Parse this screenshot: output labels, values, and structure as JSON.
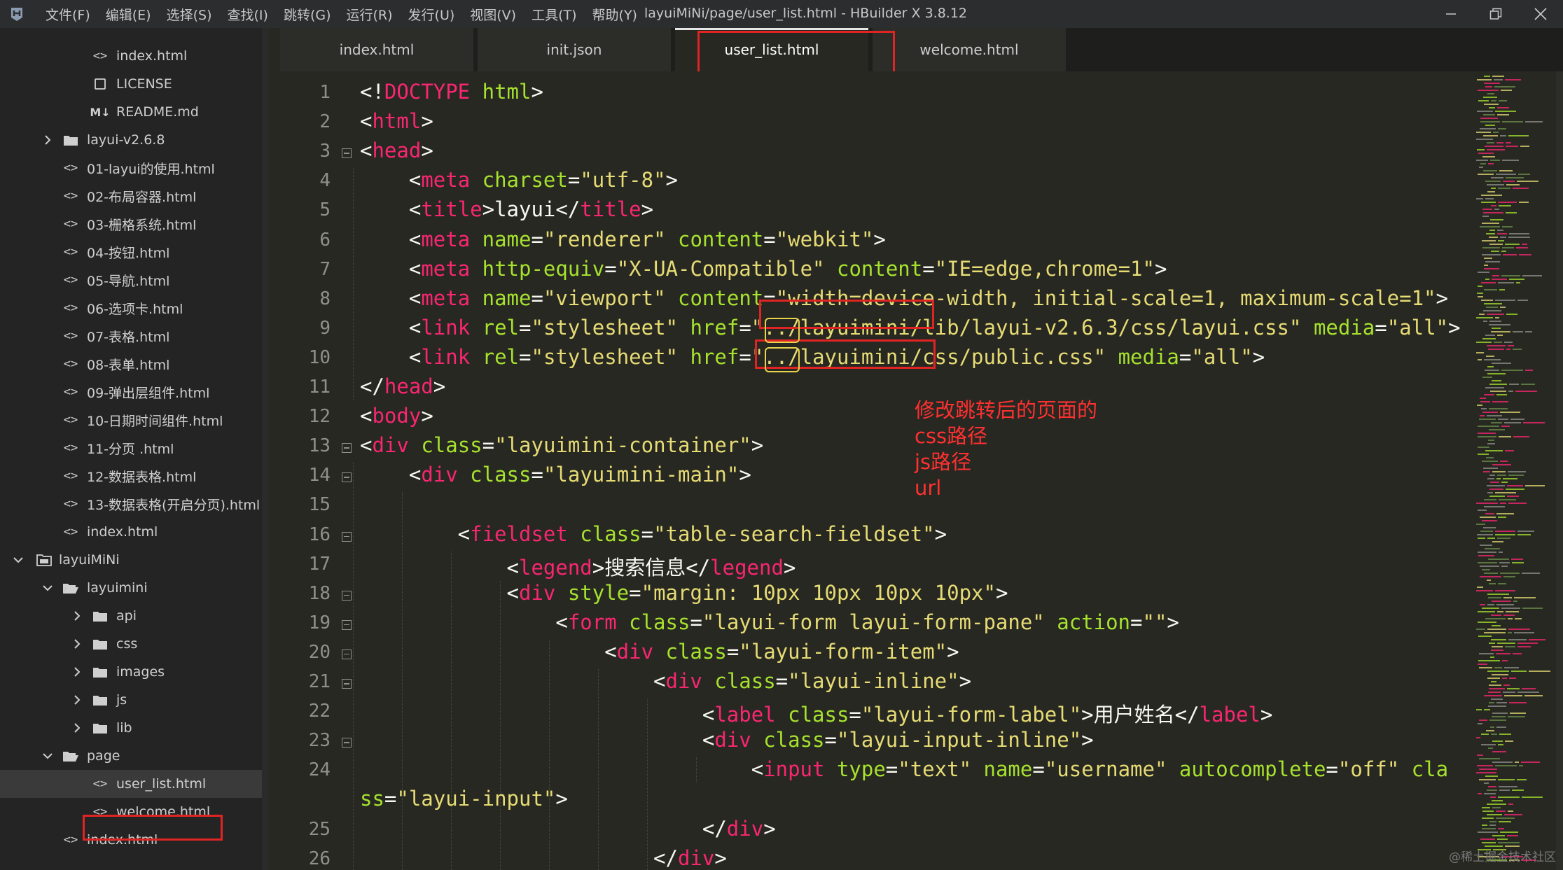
{
  "app": {
    "window_title": "layuiMiNi/page/user_list.html - HBuilder X 3.8.12",
    "menu": [
      "文件(F)",
      "编辑(E)",
      "选择(S)",
      "查找(I)",
      "跳转(G)",
      "运行(R)",
      "发行(U)",
      "视图(V)",
      "工具(T)",
      "帮助(Y)"
    ]
  },
  "sidebar": {
    "items": [
      {
        "label": "index.html",
        "icon": "code-file-icon",
        "depth": 3
      },
      {
        "label": "LICENSE",
        "icon": "plain-file-icon",
        "depth": 3
      },
      {
        "label": "README.md",
        "icon": "markdown-file-icon",
        "depth": 3
      },
      {
        "label": "layui-v2.6.8",
        "icon": "folder-icon",
        "depth": 2,
        "chevron": "right"
      },
      {
        "label": "01-layui的使用.html",
        "icon": "code-file-icon",
        "depth": 2
      },
      {
        "label": "02-布局容器.html",
        "icon": "code-file-icon",
        "depth": 2
      },
      {
        "label": "03-栅格系统.html",
        "icon": "code-file-icon",
        "depth": 2
      },
      {
        "label": "04-按钮.html",
        "icon": "code-file-icon",
        "depth": 2
      },
      {
        "label": "05-导航.html",
        "icon": "code-file-icon",
        "depth": 2
      },
      {
        "label": "06-选项卡.html",
        "icon": "code-file-icon",
        "depth": 2
      },
      {
        "label": "07-表格.html",
        "icon": "code-file-icon",
        "depth": 2
      },
      {
        "label": "08-表单.html",
        "icon": "code-file-icon",
        "depth": 2
      },
      {
        "label": "09-弹出层组件.html",
        "icon": "code-file-icon",
        "depth": 2
      },
      {
        "label": "10-日期时间组件.html",
        "icon": "code-file-icon",
        "depth": 2
      },
      {
        "label": "11-分页 .html",
        "icon": "code-file-icon",
        "depth": 2
      },
      {
        "label": "12-数据表格.html",
        "icon": "code-file-icon",
        "depth": 2
      },
      {
        "label": "13-数据表格(开启分页).html",
        "icon": "code-file-icon",
        "depth": 2
      },
      {
        "label": "index.html",
        "icon": "code-file-icon",
        "depth": 2
      },
      {
        "label": "layuiMiNi",
        "icon": "project-icon",
        "depth": 1,
        "chevron": "down"
      },
      {
        "label": "layuimini",
        "icon": "folder-open-icon",
        "depth": 2,
        "chevron": "down"
      },
      {
        "label": "api",
        "icon": "folder-icon",
        "depth": 3,
        "chevron": "right"
      },
      {
        "label": "css",
        "icon": "folder-icon",
        "depth": 3,
        "chevron": "right"
      },
      {
        "label": "images",
        "icon": "folder-icon",
        "depth": 3,
        "chevron": "right"
      },
      {
        "label": "js",
        "icon": "folder-icon",
        "depth": 3,
        "chevron": "right"
      },
      {
        "label": "lib",
        "icon": "folder-icon",
        "depth": 3,
        "chevron": "right"
      },
      {
        "label": "page",
        "icon": "folder-open-icon",
        "depth": 2,
        "chevron": "down"
      },
      {
        "label": "user_list.html",
        "icon": "code-file-icon",
        "depth": 3,
        "selected": true
      },
      {
        "label": "welcome.html",
        "icon": "code-file-icon",
        "depth": 3
      },
      {
        "label": "index.html",
        "icon": "code-file-icon",
        "depth": 2
      }
    ]
  },
  "tabs": [
    {
      "label": "index.html",
      "active": false
    },
    {
      "label": "init.json",
      "active": false
    },
    {
      "label": "user_list.html",
      "active": true
    },
    {
      "label": "welcome.html",
      "active": false
    }
  ],
  "editor": {
    "line_numbers": [
      "1",
      "2",
      "3",
      "4",
      "5",
      "6",
      "7",
      "8",
      "9",
      "10",
      "11",
      "12",
      "13",
      "14",
      "15",
      "16",
      "17",
      "18",
      "19",
      "20",
      "21",
      "22",
      "23",
      "24",
      "",
      "25",
      "26"
    ],
    "lines": [
      {
        "tokens": [
          [
            "pn",
            "<!"
          ],
          [
            "tg",
            "DOCTYPE"
          ],
          [
            "pn",
            " "
          ],
          [
            "at",
            "html"
          ],
          [
            "pn",
            ">"
          ]
        ]
      },
      {
        "tokens": [
          [
            "pn",
            "<"
          ],
          [
            "tg",
            "html"
          ],
          [
            "pn",
            ">"
          ]
        ]
      },
      {
        "tokens": [
          [
            "pn",
            "<"
          ],
          [
            "tg",
            "head"
          ],
          [
            "pn",
            ">"
          ]
        ]
      },
      {
        "tokens": [
          [
            "pn",
            "    <"
          ],
          [
            "tg",
            "meta"
          ],
          [
            "pn",
            " "
          ],
          [
            "at",
            "charset"
          ],
          [
            "pn",
            "="
          ],
          [
            "st",
            "\"utf-8\""
          ],
          [
            "pn",
            ">"
          ]
        ]
      },
      {
        "tokens": [
          [
            "pn",
            "    <"
          ],
          [
            "tg",
            "title"
          ],
          [
            "pn",
            ">"
          ],
          [
            "tx",
            "layui"
          ],
          [
            "pn",
            "</"
          ],
          [
            "tg",
            "title"
          ],
          [
            "pn",
            ">"
          ]
        ]
      },
      {
        "tokens": [
          [
            "pn",
            "    <"
          ],
          [
            "tg",
            "meta"
          ],
          [
            "pn",
            " "
          ],
          [
            "at",
            "name"
          ],
          [
            "pn",
            "="
          ],
          [
            "st",
            "\"renderer\""
          ],
          [
            "pn",
            " "
          ],
          [
            "at",
            "content"
          ],
          [
            "pn",
            "="
          ],
          [
            "st",
            "\"webkit\""
          ],
          [
            "pn",
            ">"
          ]
        ]
      },
      {
        "tokens": [
          [
            "pn",
            "    <"
          ],
          [
            "tg",
            "meta"
          ],
          [
            "pn",
            " "
          ],
          [
            "at",
            "http-equiv"
          ],
          [
            "pn",
            "="
          ],
          [
            "st",
            "\"X-UA-Compatible\""
          ],
          [
            "pn",
            " "
          ],
          [
            "at",
            "content"
          ],
          [
            "pn",
            "="
          ],
          [
            "st",
            "\"IE=edge,chrome=1\""
          ],
          [
            "pn",
            ">"
          ]
        ]
      },
      {
        "tokens": [
          [
            "pn",
            "    <"
          ],
          [
            "tg",
            "meta"
          ],
          [
            "pn",
            " "
          ],
          [
            "at",
            "name"
          ],
          [
            "pn",
            "="
          ],
          [
            "st",
            "\"viewport\""
          ],
          [
            "pn",
            " "
          ],
          [
            "at",
            "content"
          ],
          [
            "pn",
            "="
          ],
          [
            "st",
            "\"width=device-width, initial-scale=1, maximum-scale=1\""
          ],
          [
            "pn",
            ">"
          ]
        ]
      },
      {
        "tokens": [
          [
            "pn",
            "    <"
          ],
          [
            "tg",
            "link"
          ],
          [
            "pn",
            " "
          ],
          [
            "at",
            "rel"
          ],
          [
            "pn",
            "="
          ],
          [
            "st",
            "\"stylesheet\""
          ],
          [
            "pn",
            " "
          ],
          [
            "at",
            "href"
          ],
          [
            "pn",
            "="
          ],
          [
            "st",
            "\"../layuimini/lib/layui-v2.6.3/css/layui.css\""
          ],
          [
            "pn",
            " "
          ],
          [
            "at",
            "media"
          ],
          [
            "pn",
            "="
          ],
          [
            "st",
            "\"all\""
          ],
          [
            "pn",
            ">"
          ]
        ]
      },
      {
        "tokens": [
          [
            "pn",
            "    <"
          ],
          [
            "tg",
            "link"
          ],
          [
            "pn",
            " "
          ],
          [
            "at",
            "rel"
          ],
          [
            "pn",
            "="
          ],
          [
            "st",
            "\"stylesheet\""
          ],
          [
            "pn",
            " "
          ],
          [
            "at",
            "href"
          ],
          [
            "pn",
            "="
          ],
          [
            "st",
            "\"../layuimini/css/public.css\""
          ],
          [
            "pn",
            " "
          ],
          [
            "at",
            "media"
          ],
          [
            "pn",
            "="
          ],
          [
            "st",
            "\"all\""
          ],
          [
            "pn",
            ">"
          ]
        ]
      },
      {
        "tokens": [
          [
            "pn",
            "</"
          ],
          [
            "tg",
            "head"
          ],
          [
            "pn",
            ">"
          ]
        ]
      },
      {
        "tokens": [
          [
            "pn",
            "<"
          ],
          [
            "tg",
            "body"
          ],
          [
            "pn",
            ">"
          ]
        ]
      },
      {
        "tokens": [
          [
            "pn",
            "<"
          ],
          [
            "tg",
            "div"
          ],
          [
            "pn",
            " "
          ],
          [
            "at",
            "class"
          ],
          [
            "pn",
            "="
          ],
          [
            "st",
            "\"layuimini-container\""
          ],
          [
            "pn",
            ">"
          ]
        ]
      },
      {
        "tokens": [
          [
            "pn",
            "    <"
          ],
          [
            "tg",
            "div"
          ],
          [
            "pn",
            " "
          ],
          [
            "at",
            "class"
          ],
          [
            "pn",
            "="
          ],
          [
            "st",
            "\"layuimini-main\""
          ],
          [
            "pn",
            ">"
          ]
        ]
      },
      {
        "tokens": []
      },
      {
        "tokens": [
          [
            "pn",
            "        <"
          ],
          [
            "tg",
            "fieldset"
          ],
          [
            "pn",
            " "
          ],
          [
            "at",
            "class"
          ],
          [
            "pn",
            "="
          ],
          [
            "st",
            "\"table-search-fieldset\""
          ],
          [
            "pn",
            ">"
          ]
        ]
      },
      {
        "tokens": [
          [
            "pn",
            "            <"
          ],
          [
            "tg",
            "legend"
          ],
          [
            "pn",
            ">"
          ],
          [
            "tx",
            "搜索信息"
          ],
          [
            "pn",
            "</"
          ],
          [
            "tg",
            "legend"
          ],
          [
            "pn",
            ">"
          ]
        ]
      },
      {
        "tokens": [
          [
            "pn",
            "            <"
          ],
          [
            "tg",
            "div"
          ],
          [
            "pn",
            " "
          ],
          [
            "at",
            "style"
          ],
          [
            "pn",
            "="
          ],
          [
            "st",
            "\"margin: 10px 10px 10px 10px\""
          ],
          [
            "pn",
            ">"
          ]
        ]
      },
      {
        "tokens": [
          [
            "pn",
            "                <"
          ],
          [
            "tg",
            "form"
          ],
          [
            "pn",
            " "
          ],
          [
            "at",
            "class"
          ],
          [
            "pn",
            "="
          ],
          [
            "st",
            "\"layui-form layui-form-pane\""
          ],
          [
            "pn",
            " "
          ],
          [
            "at",
            "action"
          ],
          [
            "pn",
            "="
          ],
          [
            "st",
            "\"\""
          ],
          [
            "pn",
            ">"
          ]
        ]
      },
      {
        "tokens": [
          [
            "pn",
            "                    <"
          ],
          [
            "tg",
            "div"
          ],
          [
            "pn",
            " "
          ],
          [
            "at",
            "class"
          ],
          [
            "pn",
            "="
          ],
          [
            "st",
            "\"layui-form-item\""
          ],
          [
            "pn",
            ">"
          ]
        ]
      },
      {
        "tokens": [
          [
            "pn",
            "                        <"
          ],
          [
            "tg",
            "div"
          ],
          [
            "pn",
            " "
          ],
          [
            "at",
            "class"
          ],
          [
            "pn",
            "="
          ],
          [
            "st",
            "\"layui-inline\""
          ],
          [
            "pn",
            ">"
          ]
        ]
      },
      {
        "tokens": [
          [
            "pn",
            "                            <"
          ],
          [
            "tg",
            "label"
          ],
          [
            "pn",
            " "
          ],
          [
            "at",
            "class"
          ],
          [
            "pn",
            "="
          ],
          [
            "st",
            "\"layui-form-label\""
          ],
          [
            "pn",
            ">"
          ],
          [
            "tx",
            "用户姓名"
          ],
          [
            "pn",
            "</"
          ],
          [
            "tg",
            "label"
          ],
          [
            "pn",
            ">"
          ]
        ]
      },
      {
        "tokens": [
          [
            "pn",
            "                            <"
          ],
          [
            "tg",
            "div"
          ],
          [
            "pn",
            " "
          ],
          [
            "at",
            "class"
          ],
          [
            "pn",
            "="
          ],
          [
            "st",
            "\"layui-input-inline\""
          ],
          [
            "pn",
            ">"
          ]
        ]
      },
      {
        "tokens": [
          [
            "pn",
            "                                <"
          ],
          [
            "tg",
            "input"
          ],
          [
            "pn",
            " "
          ],
          [
            "at",
            "type"
          ],
          [
            "pn",
            "="
          ],
          [
            "st",
            "\"text\""
          ],
          [
            "pn",
            " "
          ],
          [
            "at",
            "name"
          ],
          [
            "pn",
            "="
          ],
          [
            "st",
            "\"username\""
          ],
          [
            "pn",
            " "
          ],
          [
            "at",
            "autocomplete"
          ],
          [
            "pn",
            "="
          ],
          [
            "st",
            "\"off\""
          ],
          [
            "pn",
            " "
          ],
          [
            "at",
            "cla"
          ]
        ]
      },
      {
        "tokens": [
          [
            "at",
            "ss"
          ],
          [
            "pn",
            "="
          ],
          [
            "st",
            "\"layui-input\""
          ],
          [
            "pn",
            ">"
          ]
        ]
      },
      {
        "tokens": [
          [
            "pn",
            "                            </"
          ],
          [
            "tg",
            "div"
          ],
          [
            "pn",
            ">"
          ]
        ]
      },
      {
        "tokens": [
          [
            "pn",
            "                        </"
          ],
          [
            "tg",
            "div"
          ],
          [
            "pn",
            ">"
          ]
        ]
      }
    ]
  },
  "annotation": {
    "lines": [
      "修改跳转后的页面的",
      "css路径",
      "js路径",
      "url"
    ]
  },
  "watermark": "@稀土掘金技术社区",
  "colors": {
    "tag": "#f92672",
    "attr": "#a6e22e",
    "string": "#e6db74",
    "text": "#f8f8f2",
    "annotation": "#ff3030",
    "highlight_box": "#e02424",
    "selection_box": "#e8d44d"
  }
}
